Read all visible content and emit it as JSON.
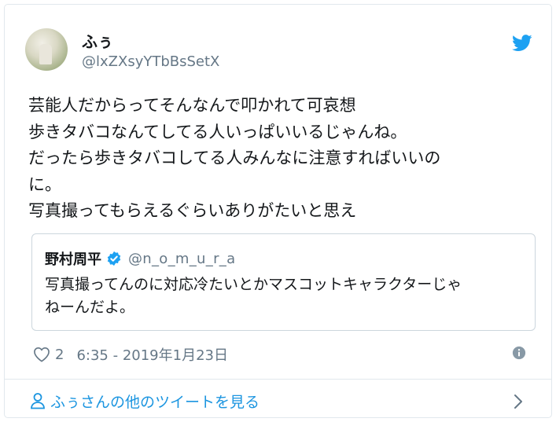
{
  "tweet": {
    "user": {
      "name": "ふぅ",
      "handle": "@lxZXsyYTbBsSetX"
    },
    "text": "芸能人だからってそんなんで叩かれて可哀想\n歩きタバコなんてしてる人いっぱいいるじゃんね。\nだったら歩きタバコしてる人みんなに注意すればいいの\nに。\n写真撮ってもらえるぐらいありがたいと思え",
    "quoted": {
      "name": "野村周平",
      "handle": "@n_o_m_u_r_a",
      "text": "写真撮ってんのに対応冷たいとかマスコットキャラクターじゃ\nねーんだよ。"
    },
    "likes": "2",
    "timestamp": "6:35 - 2019年1月23日"
  },
  "footer": {
    "link_label": "ふぅさんの他のツイートを見る"
  },
  "colors": {
    "twitter_blue": "#1da1f2",
    "link_blue": "#1b95e0",
    "secondary_text": "#657786",
    "border": "#e1e8ed"
  },
  "icons": [
    "twitter-logo-icon",
    "verified-badge-icon",
    "heart-icon",
    "info-icon",
    "person-icon",
    "chevron-right-icon"
  ]
}
